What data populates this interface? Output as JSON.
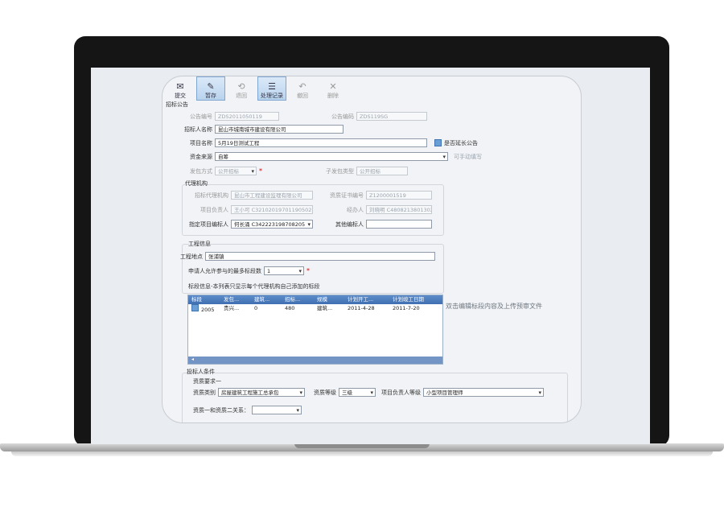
{
  "toolbar": {
    "buttons": [
      {
        "label": "提交",
        "icon": "submit-icon"
      },
      {
        "label": "暂存",
        "icon": "save-icon"
      },
      {
        "label": "退回",
        "icon": "return-icon"
      },
      {
        "label": "处理记录",
        "icon": "record-icon"
      },
      {
        "label": "撤回",
        "icon": "withdraw-icon"
      },
      {
        "label": "删除",
        "icon": "delete-icon"
      }
    ]
  },
  "section_title": "招标公告",
  "form": {
    "notice_no_label": "公告编号",
    "notice_no_value": "ZDS2011050119",
    "notice_code_label": "公告编码",
    "notice_code_value": "ZDS119SG",
    "tenderer_label": "招标人名称",
    "tenderer_value": "昆山市城南城市建设有限公司",
    "project_label": "项目名称",
    "project_value": "5月19日测试工程",
    "extend_notice_label": "是否延长公告",
    "fund_label": "资金来源",
    "fund_value": "自筹",
    "fund_hint": "可手动填写",
    "publish_mode_label": "发包方式",
    "publish_mode_value": "公开招标",
    "sub_type_label": "子发包类型",
    "sub_type_value": "公开招标"
  },
  "agency": {
    "title": "代理机构",
    "agency_label": "招标代理机构",
    "agency_value": "昆山市工程建设监理有限公司",
    "cert_label": "资质证书编号",
    "cert_value": "Z1200001519",
    "manager_label": "项目负责人",
    "manager_value": "王小可 C32102019701190502",
    "handler_label": "经办人",
    "handler_value": "刘晓明 C4808213801302",
    "editor_label": "指定项目编标人",
    "editor_value": "何长涌 C342223198708205",
    "other_label": "其他编标人"
  },
  "project": {
    "title": "工程信息",
    "location_label": "工程地点",
    "location_value": "张浦镇",
    "max_bid_label": "申请人允许参与的最多标段数",
    "max_bid_value": "1",
    "section_note": "标段信息-本列表只显示每个代理机构自己添加的标段"
  },
  "grid": {
    "headers": [
      "标段",
      "发包...",
      "建筑...",
      "招标...",
      "规模",
      "计划开工...",
      "计划竣工日期"
    ],
    "rows": [
      [
        "2005",
        "贵兴...",
        "0",
        "480",
        "建筑...",
        "2011-4-28",
        "2011-7-20"
      ]
    ]
  },
  "side_note": "双击编辑标段内容及上传预审文件",
  "conditions": {
    "title": "投标人条件",
    "req_title": "资质要求一",
    "qual_type_label": "资质类别",
    "qual_type_value": "房屋建筑工程施工总承包",
    "qual_level_label": "资质等级",
    "qual_level_value": "三级",
    "manager_level_label": "项目负责人等级",
    "manager_level_value": "小型项目管理师",
    "relation_label": "资质一和资质二关系："
  }
}
